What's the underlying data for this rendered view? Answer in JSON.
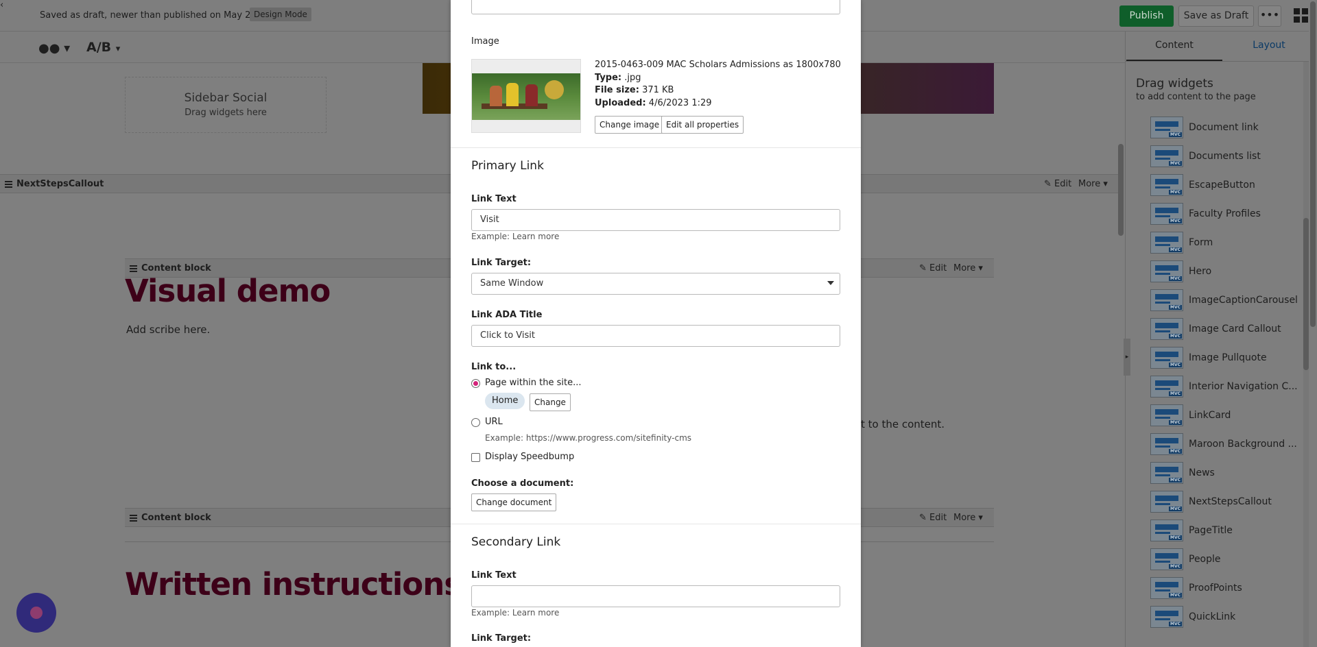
{
  "topbar": {
    "status": "Saved as draft, newer than published on May 24",
    "mode_badge": "Design Mode",
    "publish": "Publish",
    "save_draft": "Save as Draft",
    "more": "•••"
  },
  "toolbar": {
    "ab": "A/B"
  },
  "canvas": {
    "sidebar_social_title": "Sidebar Social",
    "sidebar_social_hint": "Drag widgets here",
    "next_steps_label": "NextStepsCallout",
    "content_block_label": "Content block",
    "edit": "Edit",
    "more": "More",
    "heading1": "Visual demo",
    "body1": "Add scribe here.",
    "body_partial": "t to the content.",
    "heading2": "Written instructions"
  },
  "right_panel": {
    "tabs": [
      "Content",
      "Layout"
    ],
    "title": "Drag widgets",
    "subtitle": "to add content to the page",
    "widgets": [
      "Document link",
      "Documents list",
      "EscapeButton",
      "Faculty Profiles",
      "Form",
      "Hero",
      "ImageCaptionCarousel",
      "Image Card Callout",
      "Image Pullquote",
      "Interior Navigation C...",
      "LinkCard",
      "Maroon Background ...",
      "News",
      "NextStepsCallout",
      "PageTitle",
      "People",
      "ProofPoints",
      "QuickLink"
    ]
  },
  "modal": {
    "image_label": "Image",
    "image_name": "2015-0463-009 MAC Scholars Admissions as 1800x780",
    "type_label": "Type:",
    "type_value": ".jpg",
    "size_label": "File size:",
    "size_value": "371 KB",
    "uploaded_label": "Uploaded:",
    "uploaded_value": "4/6/2023 1:29",
    "change_image": "Change image",
    "edit_props": "Edit all properties",
    "primary_link": "Primary Link",
    "link_text_label": "Link Text",
    "link_text_value": "Visit",
    "link_text_help": "Example: Learn more",
    "link_target_label": "Link Target:",
    "link_target_value": "Same Window",
    "ada_label": "Link ADA Title",
    "ada_value": "Click to Visit",
    "link_to_label": "Link to...",
    "opt_page": "Page within the site...",
    "page_pill": "Home",
    "change": "Change",
    "opt_url": "URL",
    "url_help": "Example: https://www.progress.com/sitefinity-cms",
    "speedbump": "Display Speedbump",
    "choose_doc": "Choose a document:",
    "change_doc": "Change document",
    "secondary_link": "Secondary Link",
    "sec_link_text_label": "Link Text",
    "sec_link_text_value": "",
    "sec_link_text_help": "Example: Learn more",
    "sec_link_target_label": "Link Target:"
  }
}
